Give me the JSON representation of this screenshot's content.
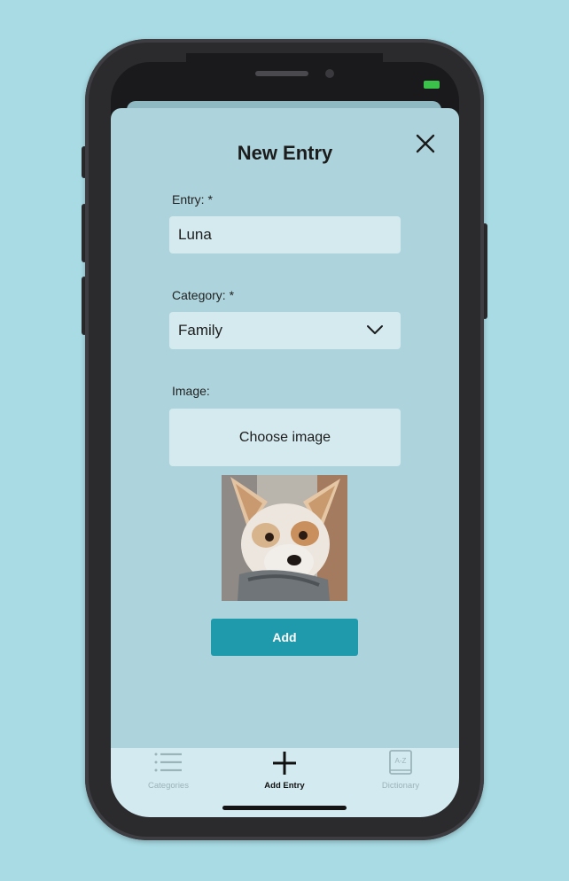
{
  "form": {
    "title": "New Entry",
    "entry_label": "Entry: *",
    "entry_value": "Luna",
    "category_label": "Category: *",
    "category_value": "Family",
    "image_label": "Image:",
    "choose_image": "Choose image",
    "add_button": "Add"
  },
  "tabs": [
    {
      "label": "Categories",
      "icon": "list-icon",
      "active": false
    },
    {
      "label": "Add Entry",
      "icon": "plus-icon",
      "active": true
    },
    {
      "label": "Dictionary",
      "icon": "book-az-icon",
      "active": false
    }
  ],
  "colors": {
    "background": "#a8dbe4",
    "accent": "#1f9aad",
    "field": "#d4eaef",
    "battery": "#3ac24a"
  }
}
